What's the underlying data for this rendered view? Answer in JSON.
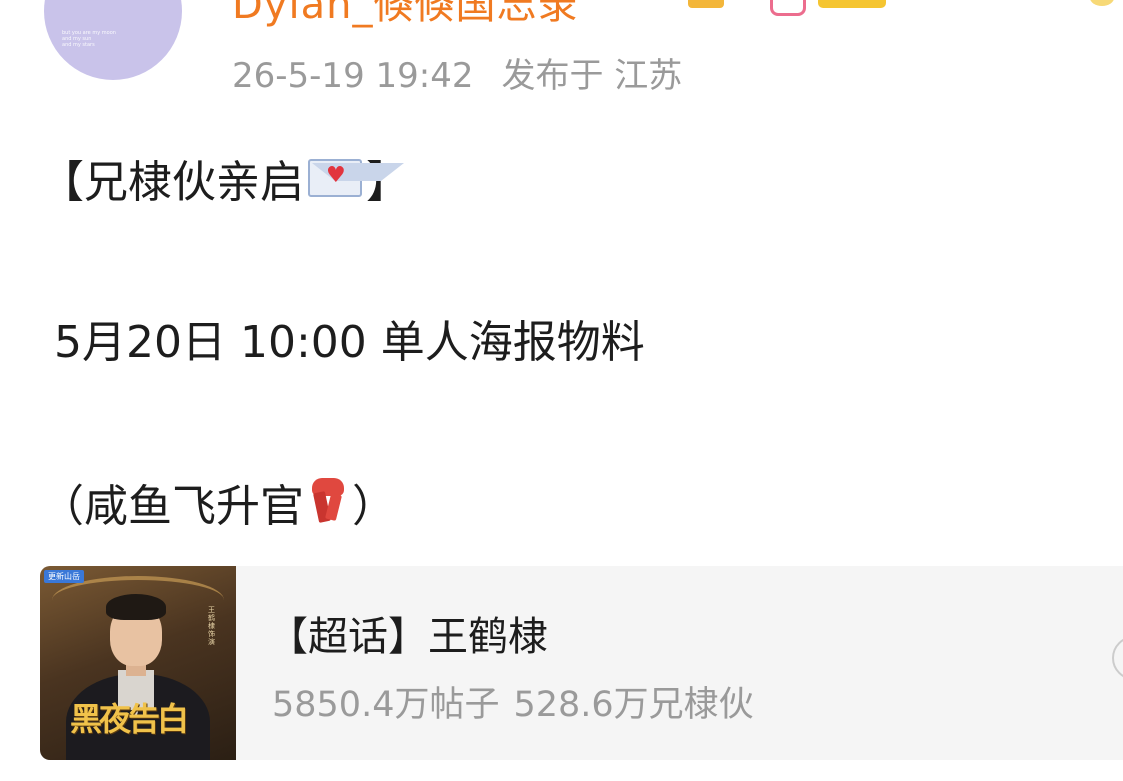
{
  "post": {
    "author_name": "Dylan_倏倏国忘录",
    "timestamp": "26-5-19 19:42",
    "location": "发布于 江苏",
    "avatar_text": "but you are my moon\nand my sun\nand my stars"
  },
  "content": {
    "line1_prefix": "【兄棣伙亲启",
    "line1_icon": "love-letter-icon",
    "line1_suffix": "】",
    "line2": "5月20日 10:00 单人海报物料",
    "line3_prefix": "（咸鱼飞升官",
    "line3_icon": "scarf-icon",
    "line3_suffix": "）"
  },
  "topic_card": {
    "title": "【超话】王鹤棣",
    "posts": "5850.4万帖子",
    "members": "528.6万兄棣伙",
    "thumb_tag": "更新山岳",
    "thumb_title": "黑夜告白",
    "thumb_vertical": "王鹤棣饰演"
  },
  "colors": {
    "username": "#f07a21",
    "meta": "#9a9a9a",
    "text": "#1d1d1d",
    "card_bg": "#f5f5f5",
    "avatar_bg": "#c9c3ea"
  }
}
